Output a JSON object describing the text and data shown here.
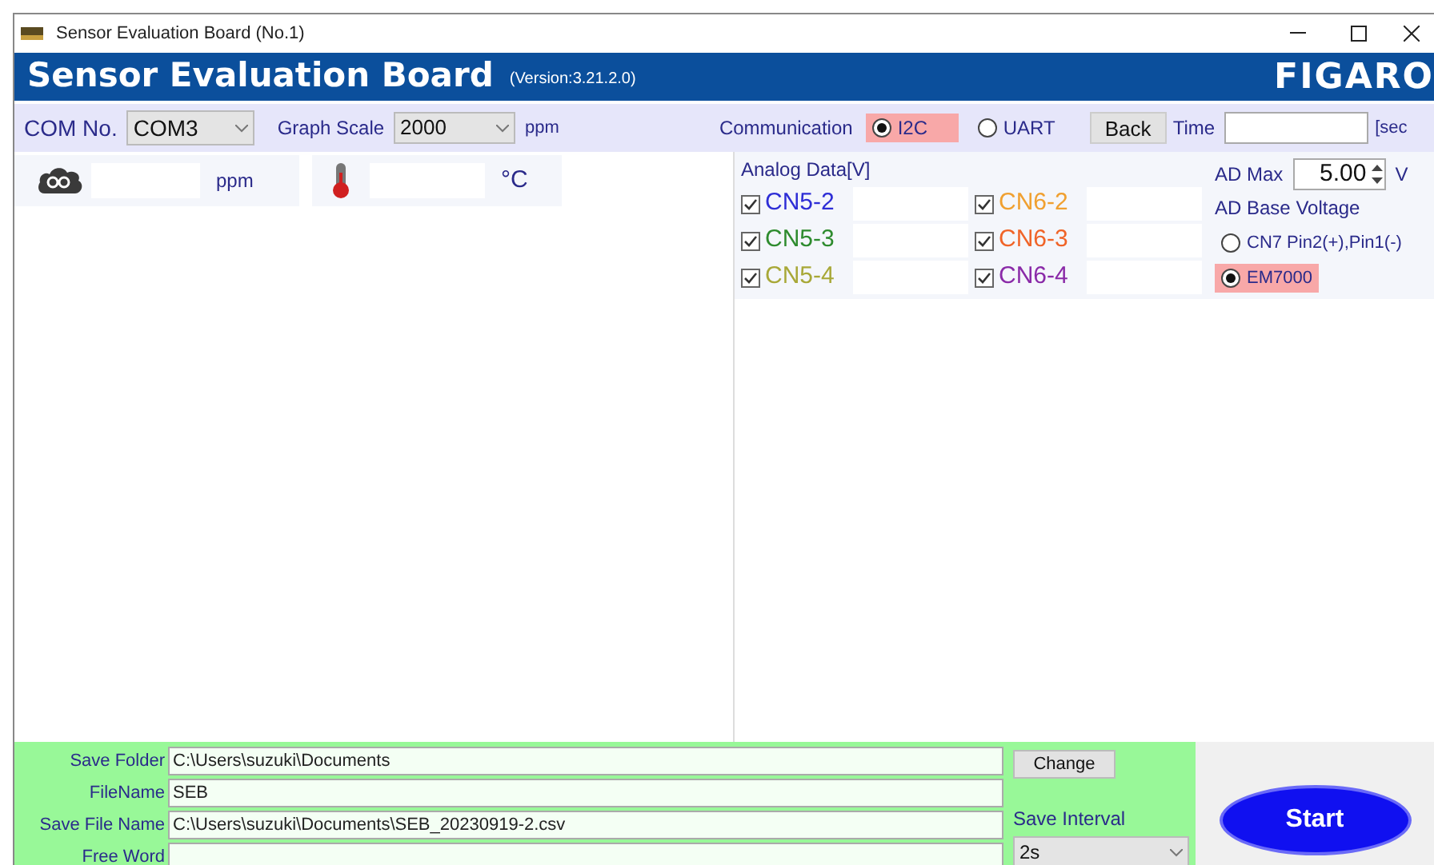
{
  "window": {
    "title": "Sensor Evaluation Board (No.1)"
  },
  "header": {
    "title": "Sensor Evaluation Board",
    "version": "(Version:3.21.2.0)",
    "logo": "FIGARO"
  },
  "toolbar": {
    "com_label": "COM No.",
    "com_value": "COM3",
    "scale_label": "Graph Scale",
    "scale_value": "2000",
    "scale_unit": "ppm",
    "communication_label": "Communication",
    "communication": [
      {
        "label": "I2C",
        "selected": true
      },
      {
        "label": "UART",
        "selected": false
      }
    ],
    "back_button": "Back",
    "time_label": "Time",
    "time_unit": "[sec"
  },
  "readings": {
    "co2_unit": "ppm",
    "temp_unit": "°C"
  },
  "analog": {
    "title": "Analog Data[V]",
    "channels": [
      {
        "label": "CN5-2",
        "checked": true,
        "color": "#2e2ed6"
      },
      {
        "label": "CN6-2",
        "checked": true,
        "color": "#f0a030"
      },
      {
        "label": "CN5-3",
        "checked": true,
        "color": "#2e8b2e"
      },
      {
        "label": "CN6-3",
        "checked": true,
        "color": "#f06428"
      },
      {
        "label": "CN5-4",
        "checked": true,
        "color": "#a8a838"
      },
      {
        "label": "CN6-4",
        "checked": true,
        "color": "#8a2aa8"
      }
    ],
    "ad_max_label": "AD Max",
    "ad_max_value": "5.00",
    "ad_max_unit": "V",
    "base_label": "AD Base Voltage",
    "base_options": [
      {
        "label": "CN7 Pin2(+),Pin1(-)",
        "selected": false
      },
      {
        "label": "EM7000",
        "selected": true
      }
    ]
  },
  "save": {
    "fields": [
      {
        "label": "Save Folder",
        "value": "C:\\Users\\suzuki\\Documents"
      },
      {
        "label": "FileName",
        "value": "SEB"
      },
      {
        "label": "Save File Name",
        "value": "C:\\Users\\suzuki\\Documents\\SEB_20230919-2.csv"
      },
      {
        "label": "Free Word"
      }
    ],
    "change_button": "Change",
    "interval_label": "Save Interval",
    "interval_value": "2s",
    "start_button": "Start"
  }
}
